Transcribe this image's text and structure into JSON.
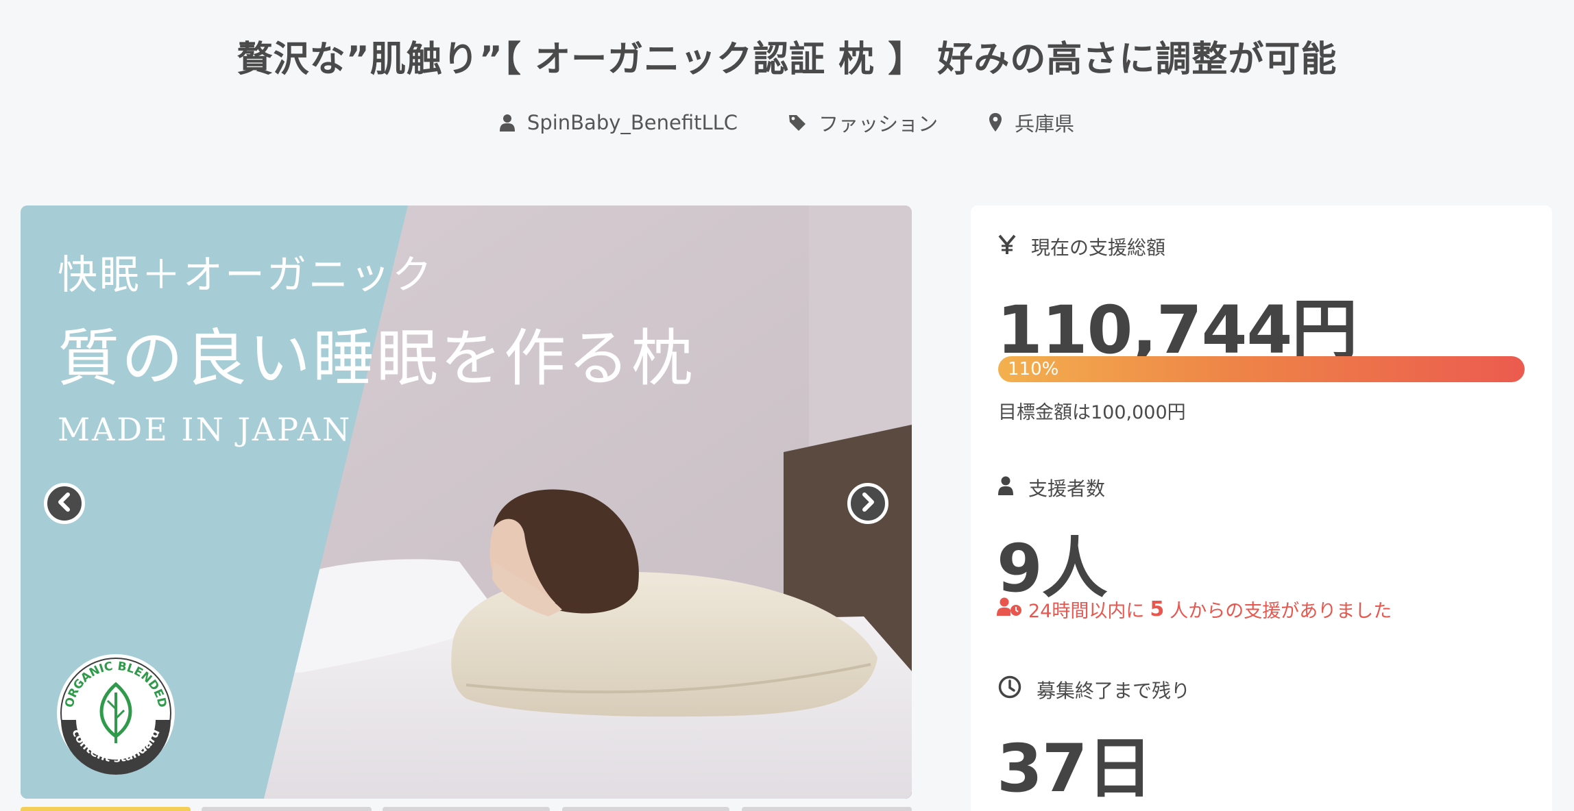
{
  "header": {
    "title": "贅沢な”肌触り”【 オーガニック認証 枕 】 好みの高さに調整が可能",
    "owner": "SpinBaby_BenefitLLC",
    "category": "ファッション",
    "location": "兵庫県",
    "owner_icon": "user-icon",
    "category_icon": "tag-icon",
    "location_icon": "map-pin-icon"
  },
  "carousel": {
    "line1": "快眠＋オーガニック",
    "line2": "質の良い睡眠を作る枕",
    "line3": "MADE IN JAPAN",
    "badge_top": "ORGANIC BLENDED",
    "badge_bottom": "content standard"
  },
  "stats": {
    "amount_label": "現在の支援総額",
    "amount_value": "110,744円",
    "progress_text": "110%",
    "progress_percent": 110,
    "goal_text": "目標金額は100,000円",
    "backers_label": "支援者数",
    "backers_value": "9人",
    "recent_prefix": "24時間以内に",
    "recent_count": "5",
    "recent_suffix": "人からの支援がありました",
    "remaining_label": "募集終了まで残り",
    "remaining_value": "37日"
  },
  "colors": {
    "accent_red": "#e8564d",
    "progress_start": "#f3b04e",
    "progress_end": "#eb5b4f",
    "hero_blue": "#a6ccd6"
  }
}
